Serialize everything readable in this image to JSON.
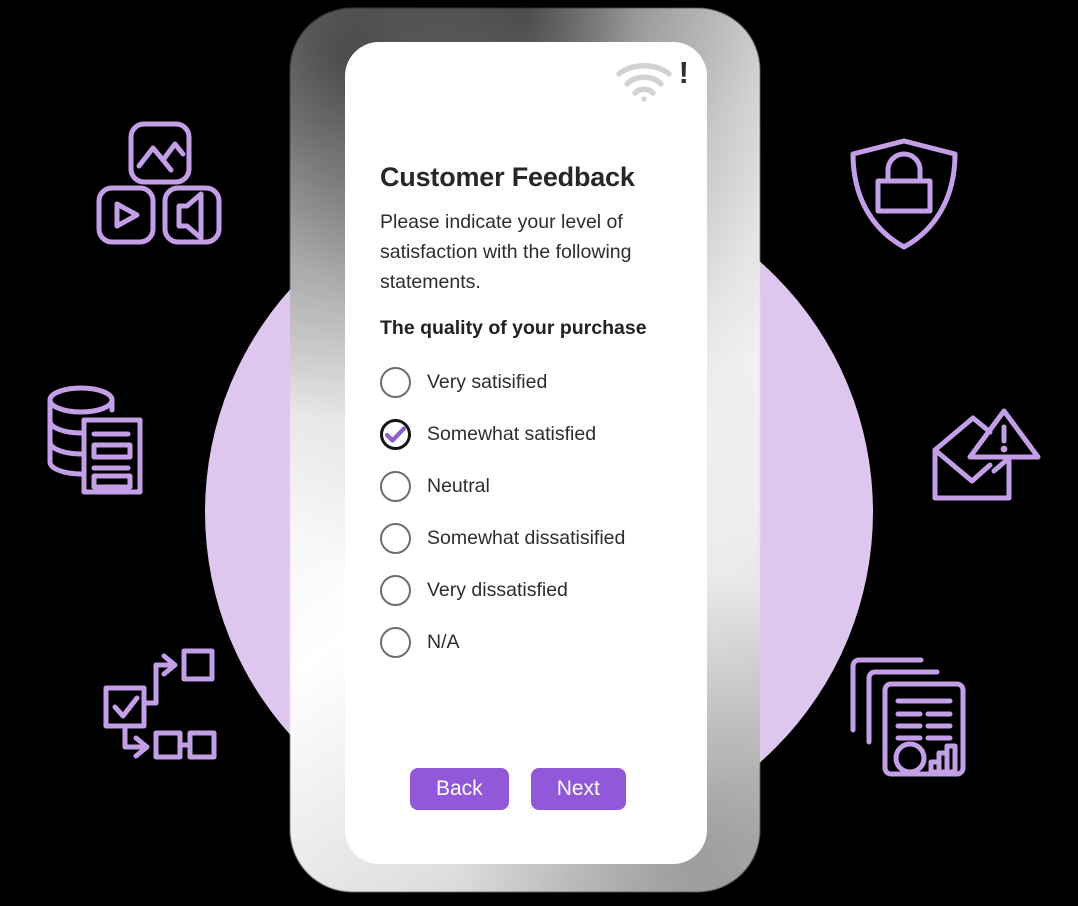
{
  "theme": {
    "background": "#000000",
    "circle_backdrop_color": "#dfc6ef",
    "accent_purple": "#9159d9",
    "icon_purple": "#c39fe8",
    "text_dark": "#2d2d31",
    "radio_ring": "#6e6e73",
    "radio_ring_selected": "#141417",
    "check_purple": "#8b5cd6",
    "wifi_gray": "#d2d2d2",
    "status_mark_dark": "#2f2f33"
  },
  "status_bar": {
    "wifi_icon": "wifi-icon",
    "no_signal_mark": "!"
  },
  "screen": {
    "title": "Customer Feedback",
    "intro": "Please indicate your level of satisfaction with the following statements.",
    "question": "The quality of your purchase",
    "options": [
      {
        "label": "Very satisified",
        "selected": false
      },
      {
        "label": "Somewhat satisfied",
        "selected": true
      },
      {
        "label": "Neutral",
        "selected": false
      },
      {
        "label": "Somewhat dissatisified",
        "selected": false
      },
      {
        "label": "Very dissatisfied",
        "selected": false
      },
      {
        "label": "N/A",
        "selected": false
      }
    ],
    "buttons": {
      "back_label": "Back",
      "next_label": "Next"
    }
  },
  "decorative_icons": [
    {
      "name": "media-blocks-icon",
      "description": "image, play and speaker tiles"
    },
    {
      "name": "database-document-icon",
      "description": "database cylinder with document"
    },
    {
      "name": "workflow-checkbox-icon",
      "description": "checked box branching to shapes"
    },
    {
      "name": "shield-lock-icon",
      "description": "shield containing a padlock"
    },
    {
      "name": "mail-warning-icon",
      "description": "envelope with warning triangle"
    },
    {
      "name": "report-stack-icon",
      "description": "stacked documents with charts"
    }
  ]
}
